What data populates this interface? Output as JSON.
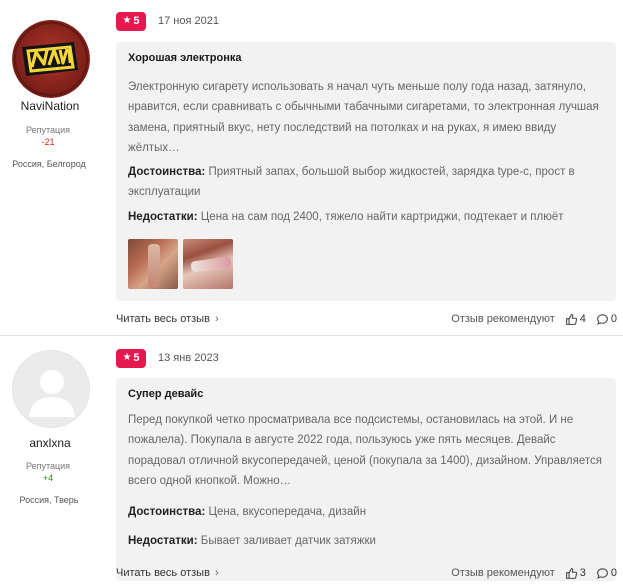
{
  "reviews": [
    {
      "author": {
        "name": "NaviNation",
        "reputation_label": "Репутация",
        "reputation_value": "-21",
        "location": "Россия, Белгород",
        "avatar_icon": "navi-logo-avatar"
      },
      "rating": "5",
      "date": "17 ноя 2021",
      "title": "Хорошая электронка",
      "text": "Электронную сигарету использовать я начал чуть меньше полу года назад, затянуло, нравится, если сравнивать с обычными табачными сигаретами, то электронная лучшая замена, приятный вкус, нету последствий на потолках и на руках, я имею ввиду жёлтых…",
      "pros_label": "Достоинства:",
      "pros": "Приятный запах, большой выбор жидкостей, зарядка type-c, прост в эксплуатации",
      "cons_label": "Недостатки:",
      "cons": "Цена на сам под 2400, тяжело найти картриджи, подтекает и плюёт",
      "read_more": "Читать весь отзыв",
      "recommend": "Отзыв рекомендуют",
      "likes": "4",
      "comments": "0"
    },
    {
      "author": {
        "name": "anxlxna",
        "reputation_label": "Репутация",
        "reputation_value": "+4",
        "location": "Россия, Тверь",
        "avatar_icon": "default-user-avatar"
      },
      "rating": "5",
      "date": "13 янв 2023",
      "title": "Супер девайс",
      "text": "Перед покупкой четко просматривала все подсистемы, остановилась на этой. И не пожалела). Покупала в августе 2022 года, пользуюсь уже пять месяцев. Девайс порадовал отличной вкусопередачей, ценой (покупала за 1400), дизайном. Управляется всего одной кнопкой. Можно…",
      "pros_label": "Достоинства:",
      "pros": "Цена, вкусопередача, дизайн",
      "cons_label": "Недостатки:",
      "cons": "Бывает заливает датчик затяжки",
      "read_more": "Читать весь отзыв",
      "recommend": "Отзыв рекомендуют",
      "likes": "3",
      "comments": "0"
    }
  ],
  "colors": {
    "rating_badge": "#e5184f",
    "rep_negative": "#d0261c",
    "rep_positive": "#2a8a2a",
    "card_bg": "#f2f2f2"
  }
}
